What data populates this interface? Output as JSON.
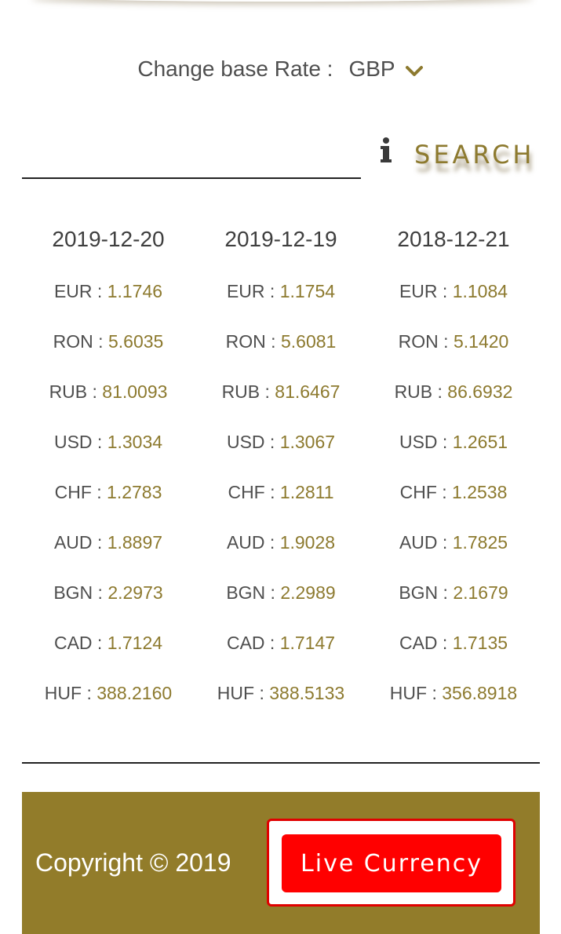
{
  "header": {
    "base_rate_label": "Change base Rate :",
    "base_currency": "GBP"
  },
  "search": {
    "input_value": "",
    "button_label": "SEARCH"
  },
  "columns": [
    {
      "date": "2019-12-20",
      "rates": [
        {
          "code": "EUR",
          "value": "1.1746"
        },
        {
          "code": "RON",
          "value": "5.6035"
        },
        {
          "code": "RUB",
          "value": "81.0093"
        },
        {
          "code": "USD",
          "value": "1.3034"
        },
        {
          "code": "CHF",
          "value": "1.2783"
        },
        {
          "code": "AUD",
          "value": "1.8897"
        },
        {
          "code": "BGN",
          "value": "2.2973"
        },
        {
          "code": "CAD",
          "value": "1.7124"
        },
        {
          "code": "HUF",
          "value": "388.2160"
        }
      ]
    },
    {
      "date": "2019-12-19",
      "rates": [
        {
          "code": "EUR",
          "value": "1.1754"
        },
        {
          "code": "RON",
          "value": "5.6081"
        },
        {
          "code": "RUB",
          "value": "81.6467"
        },
        {
          "code": "USD",
          "value": "1.3067"
        },
        {
          "code": "CHF",
          "value": "1.2811"
        },
        {
          "code": "AUD",
          "value": "1.9028"
        },
        {
          "code": "BGN",
          "value": "2.2989"
        },
        {
          "code": "CAD",
          "value": "1.7147"
        },
        {
          "code": "HUF",
          "value": "388.5133"
        }
      ]
    },
    {
      "date": "2018-12-21",
      "rates": [
        {
          "code": "EUR",
          "value": "1.1084"
        },
        {
          "code": "RON",
          "value": "5.1420"
        },
        {
          "code": "RUB",
          "value": "86.6932"
        },
        {
          "code": "USD",
          "value": "1.2651"
        },
        {
          "code": "CHF",
          "value": "1.2538"
        },
        {
          "code": "AUD",
          "value": "1.7825"
        },
        {
          "code": "BGN",
          "value": "2.1679"
        },
        {
          "code": "CAD",
          "value": "1.7135"
        },
        {
          "code": "HUF",
          "value": "356.8918"
        }
      ]
    }
  ],
  "footer": {
    "copyright": "Copyright © 2019",
    "live_button_label": "Live Currency"
  },
  "colors": {
    "accent_gold": "#8d7a2f",
    "footer_bg": "#927c2a",
    "live_button": "#ff0000"
  },
  "icons": {
    "base_dropdown": "chevron-down-icon",
    "info": "info-icon"
  }
}
